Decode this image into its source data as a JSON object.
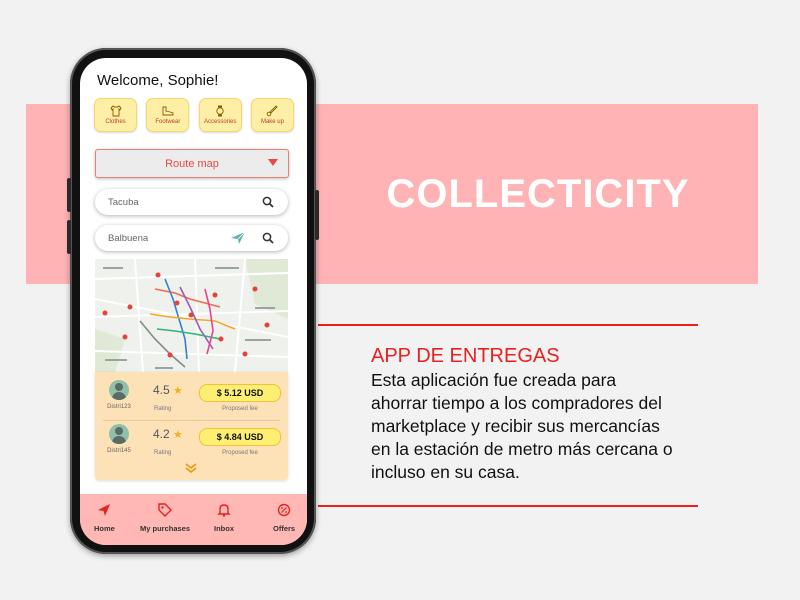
{
  "brand": {
    "title": "COLLECTICITY"
  },
  "description": {
    "heading": "APP DE ENTREGAS",
    "lines": [
      "Esta aplicación fue creada para",
      "ahorrar tiempo a los compradores del",
      "marketplace y recibir sus mercancías",
      "en la estación de metro más cercana o",
      "incluso en su casa."
    ]
  },
  "app": {
    "welcome": "Welcome, Sophie!",
    "categories": [
      {
        "label": "Clothes",
        "icon": "shirt-icon"
      },
      {
        "label": "Footwear",
        "icon": "shoe-icon"
      },
      {
        "label": "Accessories",
        "icon": "watch-icon"
      },
      {
        "label": "Make up",
        "icon": "brush-icon"
      }
    ],
    "route_select": {
      "selected": "Route map"
    },
    "origin": {
      "value": "Tacuba"
    },
    "destination": {
      "value": "Balbuena"
    },
    "offers": [
      {
        "driver": "Distri123",
        "rating": "4.5",
        "rating_label": "Rating",
        "fee": "$ 5.12 USD",
        "fee_label": "Proposed fee"
      },
      {
        "driver": "Distri145",
        "rating": "4.2",
        "rating_label": "Rating",
        "fee": "$ 4.84 USD",
        "fee_label": "Proposed fee"
      }
    ],
    "tabs": [
      {
        "label": "Home",
        "icon": "send-icon"
      },
      {
        "label": "My purchases",
        "icon": "tag-icon"
      },
      {
        "label": "Inbox",
        "icon": "bell-icon"
      },
      {
        "label": "Offers",
        "icon": "offers-icon"
      }
    ]
  },
  "colors": {
    "band": "#ffb3b5",
    "accent_red": "#e8201f",
    "pill_yellow": "#fcef72",
    "panel_peach": "#fde2b8",
    "tabbar_pink": "#ffb8b4"
  }
}
